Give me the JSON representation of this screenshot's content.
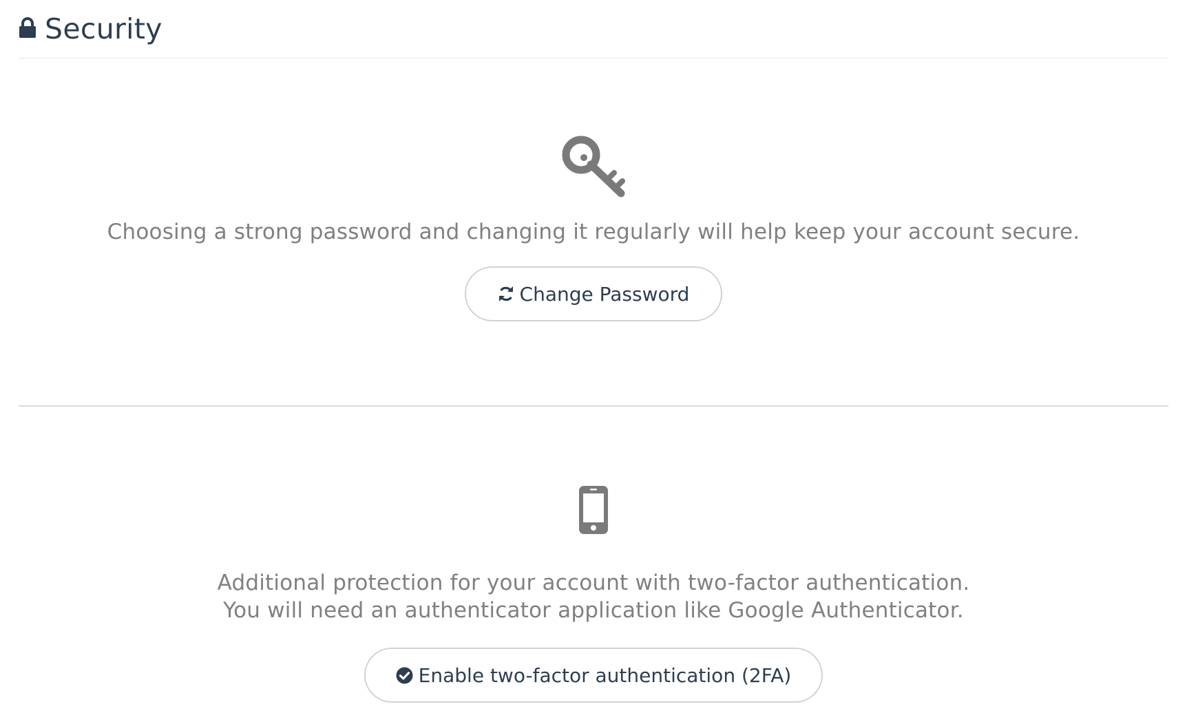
{
  "header": {
    "title": "Security",
    "icon": "lock-icon"
  },
  "password_section": {
    "icon": "key-icon",
    "description": "Choosing a strong password and changing it regularly will help keep your account secure.",
    "button_icon": "refresh-icon",
    "button_label": "Change Password"
  },
  "twofa_section": {
    "icon": "mobile-phone-icon",
    "description_line1": "Additional protection for your account with two-factor authentication.",
    "description_line2": "You will need an authenticator application like Google Authenticator.",
    "button_icon": "check-circle-icon",
    "button_label": "Enable two-factor authentication (2FA)"
  },
  "colors": {
    "heading": "#2c3e50",
    "muted_text": "#808080",
    "icon_gray": "#7a7a7a",
    "border": "#cfd3d7"
  }
}
